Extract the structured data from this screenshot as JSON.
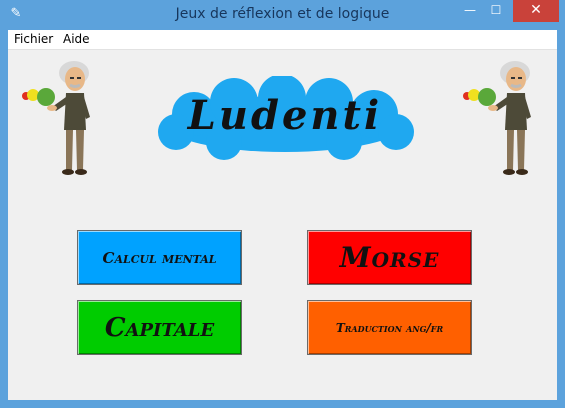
{
  "window": {
    "title": "Jeux de réflexion et de logique",
    "controls": {
      "minimize": "—",
      "maximize": "☐",
      "close": "✕"
    },
    "icon": "feather-icon"
  },
  "menu": {
    "items": [
      {
        "label": "Fichier"
      },
      {
        "label": "Aide"
      }
    ]
  },
  "logo": {
    "text": "Ludenti",
    "cloud_color": "#1fa8f0"
  },
  "buttons": {
    "calcul": {
      "label": "Calcul mental",
      "color": "#00a2ff"
    },
    "morse": {
      "label": "Morse",
      "color": "#ff0000"
    },
    "capitale": {
      "label": "Capitale",
      "color": "#00cc00"
    },
    "traduction": {
      "label": "Traduction ang/fr",
      "color": "#ff6000"
    }
  },
  "images": {
    "left": "einstein-juggling-icon",
    "right": "einstein-juggling-icon"
  }
}
